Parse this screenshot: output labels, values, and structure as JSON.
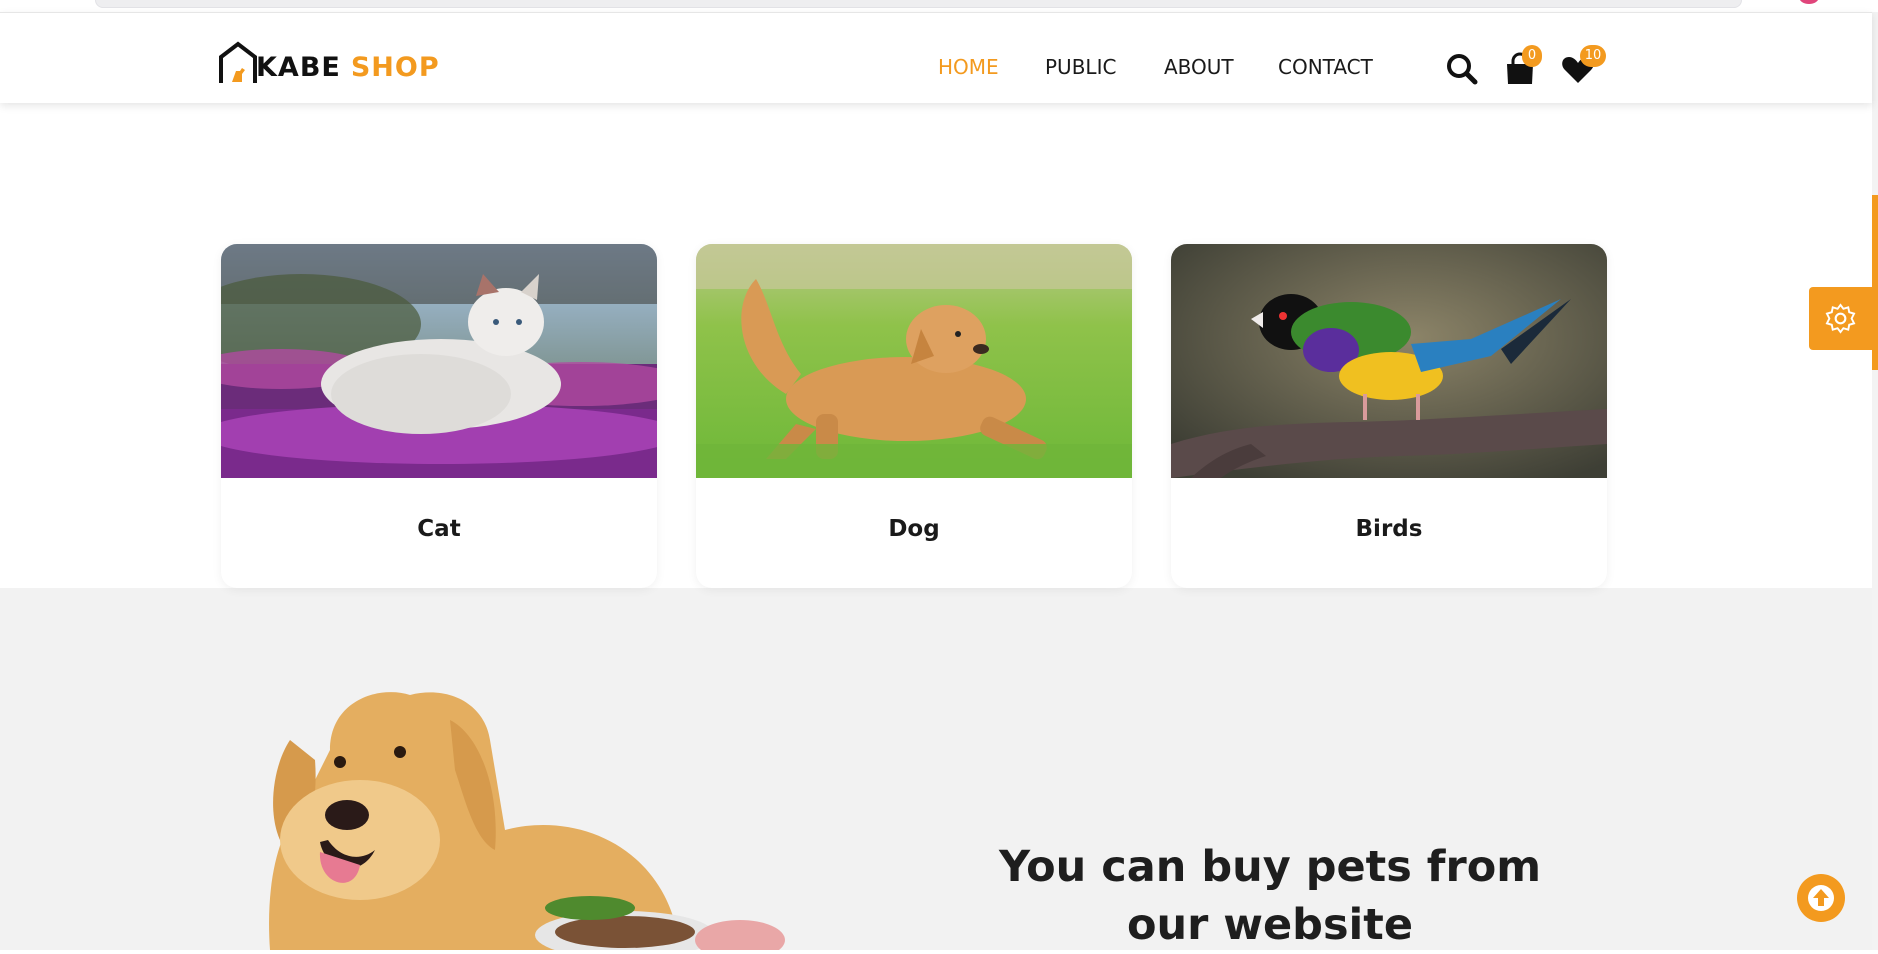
{
  "brand": {
    "name_part1": "KABE",
    "name_part2": "SHOP",
    "accent_color": "#f39a1f"
  },
  "nav": {
    "items": [
      {
        "label": "HOME",
        "active": true
      },
      {
        "label": "PUBLIC",
        "active": false
      },
      {
        "label": "ABOUT",
        "active": false
      },
      {
        "label": "CONTACT",
        "active": false
      }
    ]
  },
  "header_icons": {
    "search": "search-icon",
    "cart": {
      "icon": "shopping-bag-icon",
      "count": "0"
    },
    "wishlist": {
      "icon": "heart-icon",
      "count": "10"
    }
  },
  "categories": [
    {
      "label": "Cat",
      "image": "cat-photo"
    },
    {
      "label": "Dog",
      "image": "dog-photo"
    },
    {
      "label": "Birds",
      "image": "bird-photo"
    }
  ],
  "promo": {
    "headline": "You can buy pets from our website"
  },
  "floating": {
    "settings": "gear-icon",
    "back_to_top": "arrow-up-icon"
  }
}
